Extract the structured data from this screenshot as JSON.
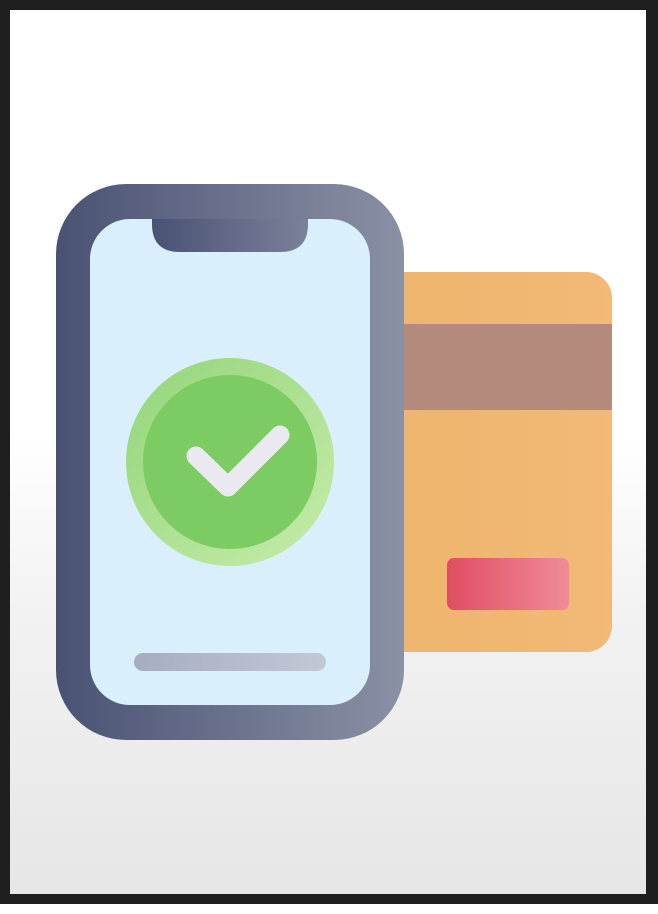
{
  "illustration": {
    "subject": "mobile-payment-success",
    "icons": [
      "phone-icon",
      "credit-card-icon",
      "check-icon"
    ]
  },
  "colors": {
    "frame": "#1f1f1f",
    "phone_body_start": "#4a5274",
    "phone_body_end": "#8a91a5",
    "phone_screen": "#d9effc",
    "card": "#f0b66f",
    "card_stripe": "#b48a7c",
    "card_chip_start": "#e04d62",
    "card_chip_end": "#f08b98",
    "check_outer": "#a8e08a",
    "check_inner": "#7ccb63",
    "check_mark": "#e9e9ef"
  }
}
